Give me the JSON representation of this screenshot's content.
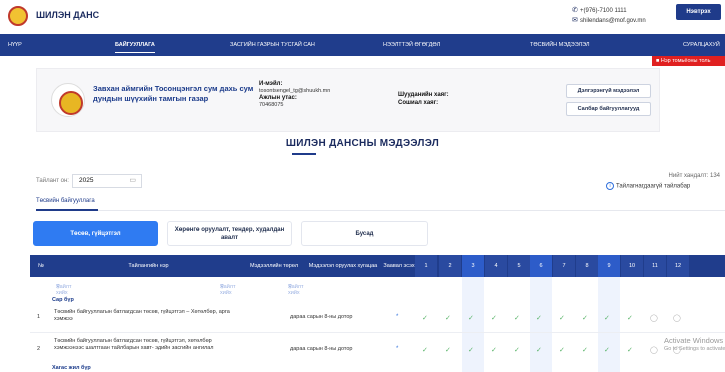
{
  "header": {
    "brand": "ШИЛЭН ДАНС",
    "phone": "+(976)-7100 1111",
    "email": "shilendans@mof.gov.mn",
    "login_label": "Нэвтрэх"
  },
  "nav": {
    "items": [
      "НҮҮР",
      "БАЙГУУЛЛАГА",
      "ЗАСГИЙН ГАЗРЫН ТУСГАЙ САН",
      "НЭЭЛТТЭЙ ӨГӨГДӨЛ",
      "ТӨСВИЙН МЭДЭЭЛЭЛ",
      "СУРАЛЦАХУЙ"
    ],
    "active_index": 1
  },
  "report_button": "Нэр томьёоны толь",
  "organization": {
    "name": "Завхан аймгийн Тосонцэнгэл сум дахь сум дундын шүүхийн тамгын газар",
    "email_label": "И-мэйл:",
    "email": "tosontsengel_tg@shuukh.mn",
    "phone_label": "Ажлын утас:",
    "phone": "70468075",
    "account_label": "Шууданийн хаяг:",
    "address_label": "Сошиал хаяг:",
    "detail_button": "Дэлгэрэнгүй мэдээлэл",
    "related_button": "Салбар байгууллагууд"
  },
  "section": {
    "title": "ШИЛЭН ДАНСНЫ МЭДЭЭЛЭЛ"
  },
  "filter": {
    "year_label": "Тайлант он:",
    "year_value": "2025",
    "total": "Нийт хандалт: 134",
    "legend": "Тайлагнагдаагүй тайлабар"
  },
  "tabs": {
    "main": "Төсвийн байгууллага"
  },
  "categories": [
    "Төсөв, гүйцэтгэл",
    "Хөрөнгө оруулалт, тендер, худалдан авалт",
    "Бусад"
  ],
  "table": {
    "headers": {
      "no": "№",
      "report_name": "Тайлангийн нэр",
      "info_type": "Мэдээллийн төрөл",
      "deadline": "Мэдээлэл оруулах хугацаа",
      "required": "Заавал эсэх",
      "months": [
        "1",
        "2",
        "3",
        "4",
        "5",
        "6",
        "7",
        "8",
        "9",
        "10",
        "11",
        "12"
      ]
    },
    "search_placeholder": "Хайлт хийх",
    "group1": "Сар бүр",
    "rows": [
      {
        "no": "1",
        "name": "Төсвийн байгууллагын батлагдсан төсөв, гүйцэтгэл – Хөтөлбөр, арга хэмжээ",
        "deadline": "дараа сарын 8-ны дотор",
        "required": "*",
        "status": [
          "done",
          "done",
          "done",
          "done",
          "done",
          "done",
          "done",
          "done",
          "done",
          "done",
          "pending",
          "pending"
        ]
      },
      {
        "no": "2",
        "name": "Төсвийн байгууллагын батлагдсан төсөв, гүйцэтгэл, хөтөлбөр хэмжээнээс шалтгаан тайлбарын хавт- эдийн засгийн ангилал",
        "deadline": "дараа сарын 8-ны дотор",
        "required": "*",
        "status": [
          "done",
          "done",
          "done",
          "done",
          "done",
          "done",
          "done",
          "done",
          "done",
          "done",
          "pending",
          "pending"
        ]
      }
    ],
    "group2": "Хагас жил бүр"
  },
  "watermark": {
    "title": "Activate Windows",
    "subtitle": "Go to Settings to activate Windows."
  }
}
